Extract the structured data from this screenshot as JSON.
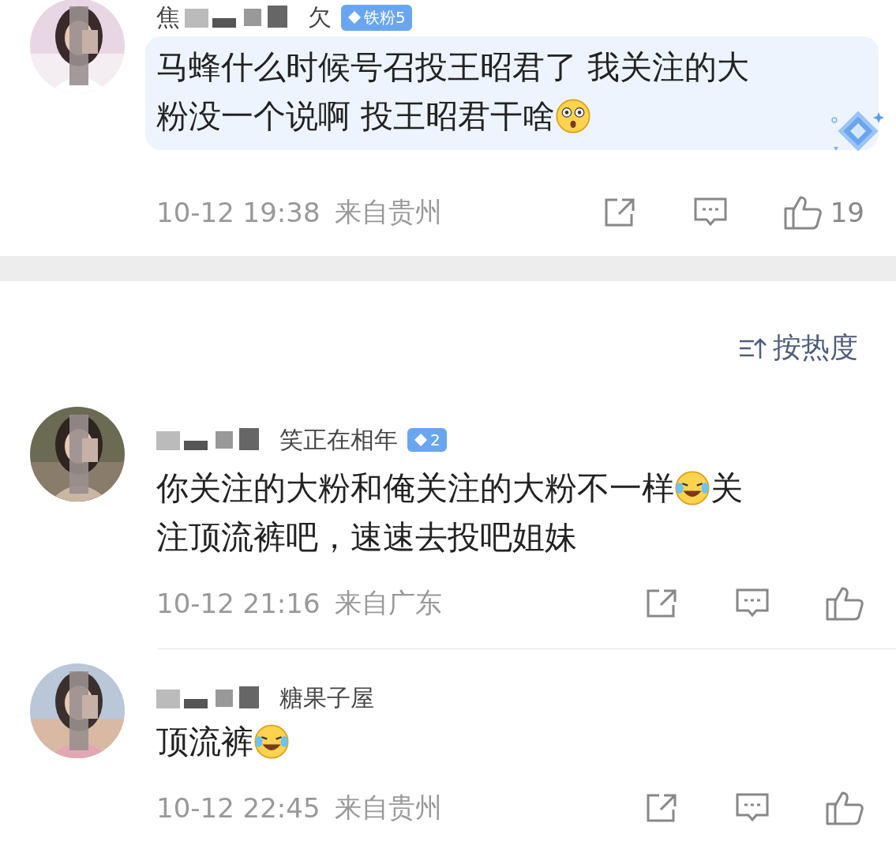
{
  "comments": [
    {
      "name_start": "焦",
      "name_end": "欠",
      "badge": "铁粉5",
      "highlighted": true,
      "lines": [
        [
          {
            "kind": "text",
            "text": "马蜂什么时候号召投王昭君了 我关注的大"
          }
        ],
        [
          {
            "kind": "text",
            "text": "粉没一个说啊 投王昭君干啥"
          },
          {
            "kind": "flushed"
          }
        ]
      ],
      "time": "10-12 19:38",
      "location": "来自贵州",
      "likes": "19"
    },
    {
      "sort": "按热度",
      "name_end": "笑正在相年",
      "badge": "2",
      "lines": [
        [
          {
            "kind": "text",
            "text": "你关注的大粉和俺关注的大粉不一样"
          },
          {
            "kind": "laughing"
          },
          {
            "kind": "text",
            "text": "关"
          }
        ],
        [
          {
            "kind": "text",
            "text": "注顶流裤吧，速速去投吧姐妹"
          }
        ]
      ],
      "time": "10-12 21:16",
      "location": "来自广东"
    },
    {
      "name_end": "糖果子屋",
      "lines": [
        [
          {
            "kind": "text",
            "text": "顶流裤"
          },
          {
            "kind": "laughing"
          }
        ]
      ],
      "time": "10-12 22:45",
      "location": "来自贵州"
    }
  ]
}
